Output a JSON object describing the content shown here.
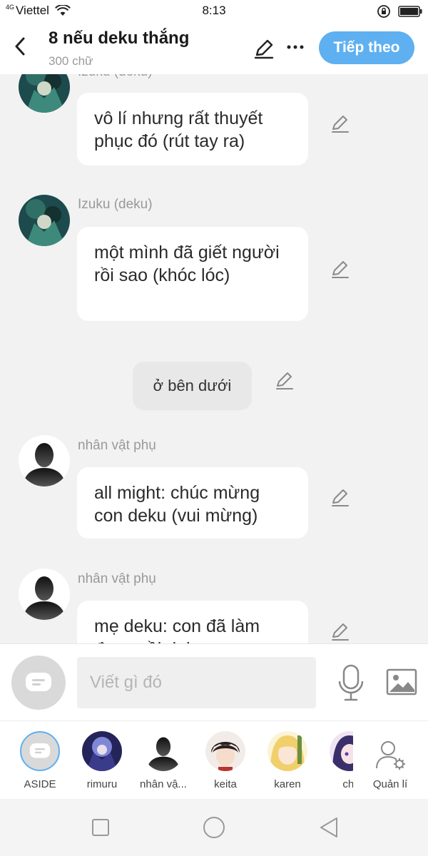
{
  "status": {
    "network": "4G",
    "carrier": "Viettel",
    "time": "8:13"
  },
  "header": {
    "title": "8 nếu deku thắng",
    "word_count": "300 chữ",
    "next_label": "Tiếp theo"
  },
  "messages": [
    {
      "name": "Izuku (deku)",
      "text": "vô lí nhưng rất thuyết phục đó (rút tay ra)"
    },
    {
      "name": "Izuku (deku)",
      "text": "một mình đã giết người rồi sao (khóc lóc)"
    },
    {
      "aside": "ở bên dưới"
    },
    {
      "name": "nhân vật phụ",
      "text": "all might: chúc mừng con deku (vui mừng)"
    },
    {
      "name": "nhân vật phụ",
      "text": "mẹ deku: con đã làm được rồi deku"
    }
  ],
  "composer": {
    "placeholder": "Viết gì đó"
  },
  "characters": [
    {
      "label": "ASIDE"
    },
    {
      "label": "rimuru"
    },
    {
      "label": "nhân vậ..."
    },
    {
      "label": "keita"
    },
    {
      "label": "karen"
    },
    {
      "label": "chi"
    },
    {
      "label": "Quản lí"
    }
  ],
  "colors": {
    "accent": "#5eb0f0",
    "bubble": "#ffffff",
    "background": "#f2f2f2",
    "aside_bubble": "#e8e8e8"
  }
}
